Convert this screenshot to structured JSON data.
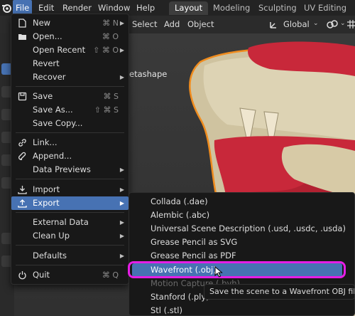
{
  "topbar": {
    "menus": [
      {
        "label": "File",
        "active": true
      },
      {
        "label": "Edit"
      },
      {
        "label": "Render"
      },
      {
        "label": "Window"
      },
      {
        "label": "Help"
      }
    ],
    "workspaces": [
      {
        "label": "Layout",
        "active": true
      },
      {
        "label": "Modeling"
      },
      {
        "label": "Sculpting"
      },
      {
        "label": "UV Editing"
      }
    ]
  },
  "viewport_header": {
    "select": "Select",
    "add": "Add",
    "object": "Object",
    "transform_orientation": "Global"
  },
  "viewport": {
    "object_name": "etashape"
  },
  "file_menu": {
    "items": [
      {
        "label": "New",
        "shortcut": "⌘ N",
        "submenu": true,
        "icon": "new-file-icon"
      },
      {
        "label": "Open...",
        "shortcut": "⌘ O",
        "icon": "folder-icon"
      },
      {
        "label": "Open Recent",
        "shortcut": "⇧ ⌘ O",
        "submenu": true
      },
      {
        "label": "Revert"
      },
      {
        "label": "Recover",
        "submenu": true
      },
      {
        "label": "Save",
        "shortcut": "⌘ S",
        "icon": "save-icon"
      },
      {
        "label": "Save As...",
        "shortcut": "⇧ ⌘ S"
      },
      {
        "label": "Save Copy..."
      },
      {
        "label": "Link...",
        "icon": "link-icon"
      },
      {
        "label": "Append...",
        "icon": "append-icon"
      },
      {
        "label": "Data Previews",
        "submenu": true
      },
      {
        "label": "Import",
        "submenu": true,
        "icon": "import-icon"
      },
      {
        "label": "Export",
        "submenu": true,
        "icon": "export-icon",
        "highlighted": true
      },
      {
        "label": "External Data",
        "submenu": true
      },
      {
        "label": "Clean Up",
        "submenu": true
      },
      {
        "label": "Defaults",
        "submenu": true
      },
      {
        "label": "Quit",
        "shortcut": "⌘ Q",
        "icon": "quit-icon"
      }
    ]
  },
  "export_menu": {
    "items": [
      {
        "label": "Collada (.dae)"
      },
      {
        "label": "Alembic (.abc)"
      },
      {
        "label": "Universal Scene Description (.usd, .usdc, .usda)"
      },
      {
        "label": "Grease Pencil as SVG"
      },
      {
        "label": "Grease Pencil as PDF"
      },
      {
        "label": "Wavefront (.obj)",
        "highlighted": true
      },
      {
        "label": "Motion Capture (.bvh)"
      },
      {
        "label": "Stanford (.ply)"
      },
      {
        "label": "Stl (.stl)"
      }
    ]
  },
  "tooltip": {
    "text": "Save the scene to a Wavefront OBJ file."
  },
  "colors": {
    "highlight": "#4772b3",
    "annotation_ring": "#e61ee6",
    "model_red": "#c8283a",
    "model_cream": "#d9cfae"
  }
}
